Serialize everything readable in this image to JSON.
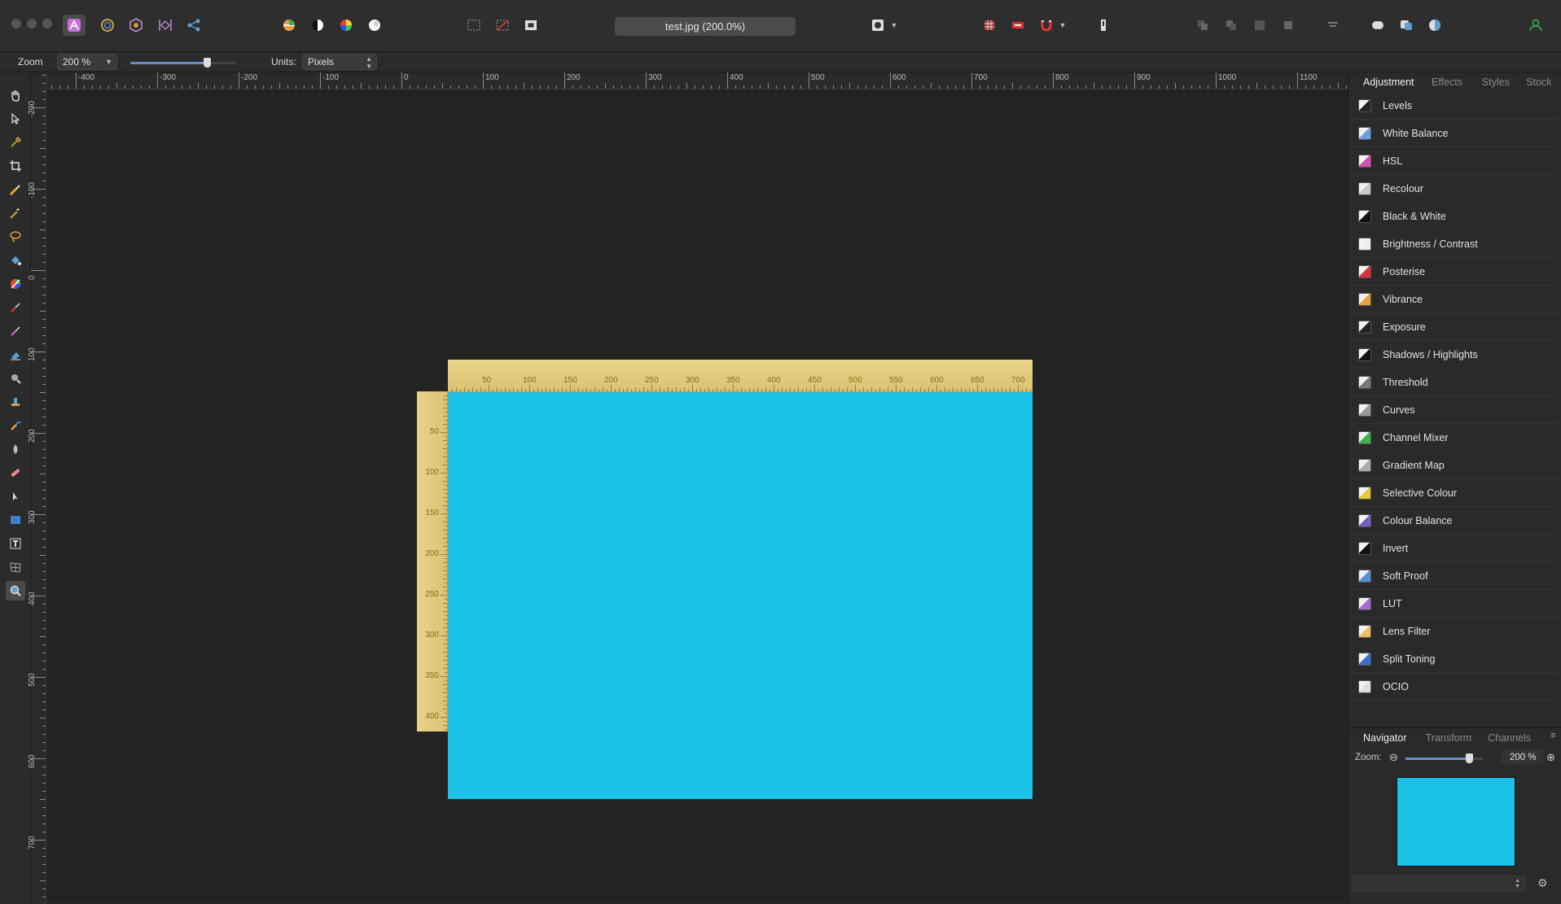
{
  "document": {
    "title": "test.jpg (200.0%)"
  },
  "toolbar": {
    "personas": [
      "photo-persona",
      "liquify-persona",
      "develop-persona",
      "tone-mapping-persona",
      "export-persona"
    ]
  },
  "context": {
    "zoom_label": "Zoom",
    "zoom_value": "200 %",
    "zoom_slider_fraction": 0.72,
    "units_label": "Units:",
    "units_value": "Pixels"
  },
  "rulers": {
    "corner_unit": "px",
    "horizontal_labels": [
      "-400",
      "-300",
      "-200",
      "-100",
      "0",
      "100",
      "200",
      "300",
      "400",
      "500",
      "600",
      "700",
      "800",
      "900",
      "1000",
      "1100"
    ],
    "vertical_labels": [
      "-200",
      "-100",
      "0",
      "100",
      "200",
      "300",
      "400",
      "500",
      "600",
      "700"
    ]
  },
  "widget_ruler": {
    "horizontal_labels": [
      "50",
      "100",
      "150",
      "200",
      "250",
      "300",
      "350",
      "400",
      "450",
      "500",
      "550",
      "600",
      "650",
      "700"
    ],
    "vertical_labels": [
      "50",
      "100",
      "150",
      "200",
      "250",
      "300",
      "350",
      "400"
    ]
  },
  "colors": {
    "image_fill": "#1bc1e6",
    "accent": "#6a8fc4"
  },
  "adjustment_panel": {
    "tabs": [
      "Adjustment",
      "Effects",
      "Styles",
      "Stock"
    ],
    "items": [
      {
        "label": "Levels",
        "icon": "levels-icon",
        "color": "#222222"
      },
      {
        "label": "White Balance",
        "icon": "white-balance-icon",
        "color": "#6aa0e0"
      },
      {
        "label": "HSL",
        "icon": "hsl-icon",
        "color": "#d24fb0"
      },
      {
        "label": "Recolour",
        "icon": "recolour-icon",
        "color": "#c9c9c9"
      },
      {
        "label": "Black & White",
        "icon": "black-white-icon",
        "color": "#111111"
      },
      {
        "label": "Brightness / Contrast",
        "icon": "brightness-contrast-icon",
        "color": "#eeeeee"
      },
      {
        "label": "Posterise",
        "icon": "posterise-icon",
        "color": "#d8323f"
      },
      {
        "label": "Vibrance",
        "icon": "vibrance-icon",
        "color": "#e8a23a"
      },
      {
        "label": "Exposure",
        "icon": "exposure-icon",
        "color": "#222222"
      },
      {
        "label": "Shadows / Highlights",
        "icon": "shadows-highlights-icon",
        "color": "#111111"
      },
      {
        "label": "Threshold",
        "icon": "threshold-icon",
        "color": "#777777"
      },
      {
        "label": "Curves",
        "icon": "curves-icon",
        "color": "#999999"
      },
      {
        "label": "Channel Mixer",
        "icon": "channel-mixer-icon",
        "color": "#3bb34a"
      },
      {
        "label": "Gradient Map",
        "icon": "gradient-map-icon",
        "color": "#aaaaaa"
      },
      {
        "label": "Selective Colour",
        "icon": "selective-colour-icon",
        "color": "#e8c83a"
      },
      {
        "label": "Colour Balance",
        "icon": "colour-balance-icon",
        "color": "#7a5cc4"
      },
      {
        "label": "Invert",
        "icon": "invert-icon",
        "color": "#111111"
      },
      {
        "label": "Soft Proof",
        "icon": "soft-proof-icon",
        "color": "#5a8fd0"
      },
      {
        "label": "LUT",
        "icon": "lut-icon",
        "color": "#a86ad0"
      },
      {
        "label": "Lens Filter",
        "icon": "lens-filter-icon",
        "color": "#f0c060"
      },
      {
        "label": "Split Toning",
        "icon": "split-toning-icon",
        "color": "#3a6fd0"
      },
      {
        "label": "OCIO",
        "icon": "ocio-icon",
        "color": "#dddddd"
      }
    ]
  },
  "navigator_panel": {
    "tabs": [
      "Navigator",
      "Transform",
      "Channels"
    ],
    "zoom_label": "Zoom:",
    "zoom_value": "200 %",
    "zoom_slider_fraction": 0.82
  }
}
